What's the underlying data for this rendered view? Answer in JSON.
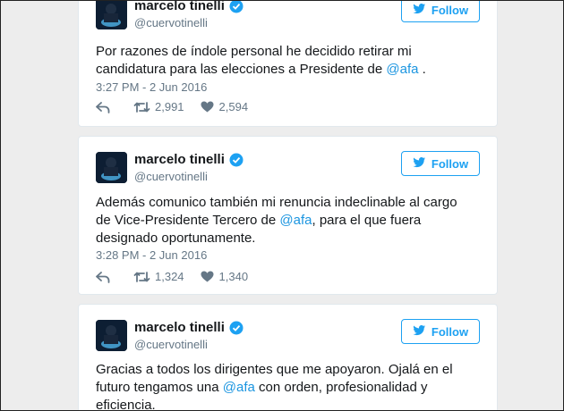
{
  "colors": {
    "accent": "#1da1f2",
    "mention": "#1b95e0",
    "muted": "#657786",
    "text": "#14171a"
  },
  "icons": {
    "verified": "verified-badge-icon",
    "follow": "twitter-bird-icon",
    "reply": "reply-icon",
    "retweet": "retweet-icon",
    "like": "heart-icon"
  },
  "tweets": [
    {
      "name": "marcelo tinelli",
      "handle": "@cuervotinelli",
      "follow_label": "Follow",
      "text_before": "Por razones de índole personal he decidido retirar mi candidatura para las elecciones a Presidente de ",
      "mention": "@afa",
      "text_after": " .",
      "time": "3:27 PM - 2 Jun 2016",
      "retweets": "2,991",
      "likes": "2,594"
    },
    {
      "name": "marcelo tinelli",
      "handle": "@cuervotinelli",
      "follow_label": "Follow",
      "text_before": "Además comunico también mi renuncia indeclinable al cargo de Vice-Presidente Tercero de ",
      "mention": "@afa",
      "text_after": ", para el que fuera designado oportunamente.",
      "time": "3:28 PM - 2 Jun 2016",
      "retweets": "1,324",
      "likes": "1,340"
    },
    {
      "name": "marcelo tinelli",
      "handle": "@cuervotinelli",
      "follow_label": "Follow",
      "text_before": "Gracias a todos los dirigentes que me apoyaron. Ojalá en el futuro tengamos una ",
      "mention": "@afa",
      "text_after": " con orden, profesionalidad y eficiencia."
    }
  ]
}
